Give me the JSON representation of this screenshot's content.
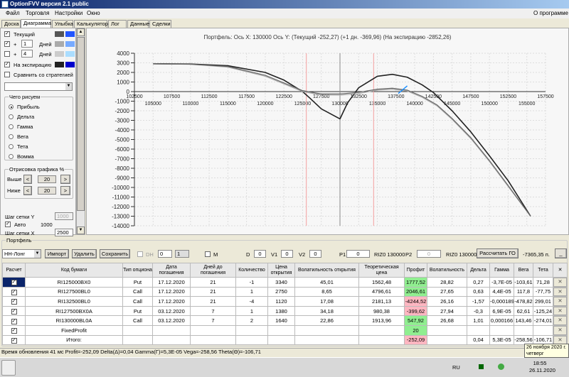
{
  "window": {
    "title": "OptionFVV версия 2.1 public"
  },
  "menu": {
    "items": [
      "Файл",
      "Торговля",
      "Настройки",
      "Окно"
    ],
    "about": "О программе"
  },
  "tabs": [
    "Доска",
    "Диаграмма",
    "Улыбка",
    "Калькулятор",
    "Лог",
    "Данные",
    "Сделки"
  ],
  "left": {
    "current_label": "Текущий",
    "plus_label": "+",
    "days1": "1",
    "days2": "4",
    "days_label": "Дней",
    "expiration_label": "На экспирацию",
    "compare_label": "Сравнить со стратегией",
    "swatches": [
      [
        "#555555",
        "#2255ff"
      ],
      [
        "#aaaaaa",
        "#77aaff"
      ],
      [
        "#cccccc",
        "#aaddff"
      ],
      [
        "#222222",
        "#0000cc"
      ]
    ],
    "draw_group": "Чего рисуем",
    "draw_options": [
      "Прибыль",
      "Дельта",
      "Гамма",
      "Вега",
      "Тета",
      "Вомма"
    ],
    "range_group": "Отрисовка графика %",
    "above_label": "Выше",
    "below_label": "Ниже",
    "above_value": "20",
    "below_value": "20",
    "prev": "<",
    "next": ">",
    "grid_y_label": "Шаг сетки Y",
    "grid_y_value": "1000",
    "auto_label": "Авто",
    "auto_value": "1000",
    "grid_x_label": "Шаг сетки X",
    "grid_x_value": "2500"
  },
  "chart_data": {
    "type": "line",
    "title": "Портфель: Ось X:  130000 Ось Y:   (Текущий -252,27)  (+1 дн. -369,96)  (На экспирацию -2852,26)",
    "xlim": [
      102500,
      157500
    ],
    "ylim": [
      -14000,
      4000
    ],
    "yticks": [
      4000,
      3000,
      2000,
      1000,
      0,
      -1000,
      -2000,
      -3000,
      -4000,
      -5000,
      -6000,
      -7000,
      -8000,
      -9000,
      -10000,
      -11000,
      -12000,
      -13000,
      -14000
    ],
    "xticks_top": [
      102500,
      107500,
      112500,
      117500,
      122500,
      127500,
      132500,
      137500,
      142500,
      147500,
      152500,
      157500
    ],
    "xticks_bottom": [
      105000,
      110000,
      115000,
      120000,
      125000,
      130000,
      135000,
      140000,
      145000,
      150000,
      155000
    ],
    "current_x": 130000,
    "red_lines": [
      125500,
      134500
    ],
    "series": [
      {
        "name": "На экспирацию",
        "color": "#222222",
        "points": [
          [
            105000,
            2900
          ],
          [
            110000,
            2880
          ],
          [
            115000,
            2700
          ],
          [
            120000,
            2000
          ],
          [
            122500,
            1200
          ],
          [
            125000,
            0
          ],
          [
            126000,
            -700
          ],
          [
            127500,
            -1800
          ],
          [
            130000,
            -2850
          ],
          [
            131000,
            -1200
          ],
          [
            132500,
            400
          ],
          [
            135000,
            1600
          ],
          [
            137000,
            1800
          ],
          [
            139000,
            1500
          ],
          [
            141000,
            700
          ],
          [
            142500,
            -100
          ],
          [
            145000,
            -2000
          ],
          [
            147500,
            -4200
          ],
          [
            150000,
            -6700
          ],
          [
            152500,
            -9300
          ],
          [
            155500,
            -13000
          ]
        ]
      },
      {
        "name": "+1 дн.",
        "color": "#aaaaaa",
        "points": [
          [
            105000,
            2900
          ],
          [
            110000,
            2840
          ],
          [
            115000,
            2550
          ],
          [
            120000,
            1600
          ],
          [
            122500,
            800
          ],
          [
            125000,
            0
          ],
          [
            127500,
            -350
          ],
          [
            130000,
            -370
          ],
          [
            132500,
            -200
          ],
          [
            135000,
            150
          ],
          [
            137000,
            250
          ],
          [
            139000,
            50
          ],
          [
            141000,
            -600
          ],
          [
            143000,
            -1500
          ],
          [
            145000,
            -2900
          ],
          [
            147500,
            -4900
          ],
          [
            150000,
            -7300
          ],
          [
            152500,
            -9900
          ],
          [
            155500,
            -13000
          ]
        ]
      },
      {
        "name": "Текущий",
        "color": "#666666",
        "points": [
          [
            105000,
            2900
          ],
          [
            110000,
            2860
          ],
          [
            115000,
            2620
          ],
          [
            120000,
            1700
          ],
          [
            122500,
            900
          ],
          [
            125000,
            100
          ],
          [
            127500,
            -250
          ],
          [
            130000,
            -252
          ],
          [
            132500,
            -80
          ],
          [
            135000,
            250
          ],
          [
            137000,
            350
          ],
          [
            139000,
            150
          ],
          [
            141000,
            -500
          ],
          [
            143000,
            -1400
          ],
          [
            145000,
            -2800
          ],
          [
            147500,
            -4800
          ],
          [
            150000,
            -7200
          ],
          [
            152500,
            -9800
          ],
          [
            155500,
            -13000
          ]
        ]
      },
      {
        "name": "marker",
        "color": "#1e90ff",
        "points": [
          [
            137800,
            -200
          ],
          [
            139000,
            600
          ]
        ]
      }
    ]
  },
  "portfolio": {
    "group": "Портфель",
    "strategy": "НН-Лонг",
    "import": "Импорт",
    "delete": "Удалить",
    "save": "Сохранить",
    "dh": "DH",
    "spin1": "0",
    "spin2": "1",
    "m": "M",
    "d_label": "D",
    "d": "0",
    "v1_label": "V1",
    "v1": "0",
    "v2_label": "V2",
    "v2": "0",
    "p1_label": "P1",
    "p1": "0",
    "riz1": "RIZ0 130000",
    "p2_label": "P2",
    "p2": "0",
    "riz2": "RIZ0 130000",
    "calc_go": "Рассчитать ГО",
    "go_value": "-7365,35 п.",
    "minimize": "_",
    "columns": [
      "Расчет",
      "Код бумаги",
      "Тип опциона",
      "Дата погашения",
      "Дней до погашения",
      "Количество",
      "Цена открытия",
      "Волатильность открытия",
      "Теоретическая цена",
      "Профит",
      "Волатильность",
      "Дельта",
      "Гамма",
      "Вега",
      "Тета",
      "✕"
    ],
    "rows": [
      [
        "RI125000BX0",
        "Put",
        "17.12.2020",
        "21",
        "-1",
        "3340",
        "45,01",
        "1562,48",
        "1777,52",
        "28,82",
        "0,27",
        "-3,7E-05",
        "-103,61",
        "71,28"
      ],
      [
        "RI127500BL0",
        "Call",
        "17.12.2020",
        "21",
        "1",
        "2750",
        "8,65",
        "4796,61",
        "2046,61",
        "27,65",
        "0,63",
        "4,4E-05",
        "117,8",
        "-77,75"
      ],
      [
        "RI132500BL0",
        "Call",
        "17.12.2020",
        "21",
        "-4",
        "1120",
        "17,08",
        "2181,13",
        "-4244,52",
        "26,16",
        "-1,57",
        "-0,000189",
        "-478,82",
        "299,01"
      ],
      [
        "RI127500BX0A",
        "Put",
        "03.12.2020",
        "7",
        "1",
        "1380",
        "34,18",
        "980,38",
        "-399,62",
        "27,94",
        "-0,3",
        "6,9E-05",
        "62,61",
        "-125,24"
      ],
      [
        "RI130000BL0A",
        "Call",
        "03.12.2020",
        "7",
        "2",
        "1640",
        "22,86",
        "1913,96",
        "547,92",
        "26,68",
        "1,01",
        "0,000166",
        "143,46",
        "-274,01"
      ],
      [
        "FixedProfit",
        "",
        "",
        "",
        "",
        "",
        "",
        "",
        "20",
        "",
        "",
        "",
        "",
        ""
      ],
      [
        "Итого:",
        "",
        "",
        "",
        "",
        "",
        "",
        "",
        "-252,09",
        "",
        "0,04",
        "5,3E-05",
        "-258,56",
        "-106,71"
      ]
    ]
  },
  "status": "Время обновления 41 мс  Profit=-252,09 Delta(Δ)=0,04 Gamma(Γ)=5,3E-05 Vega=-258,56 Theta(Θ)=-106,71",
  "tooltip": {
    "line1": "26 ноября 2020 г.",
    "line2": "четверг"
  },
  "taskbar": {
    "lang": "RU",
    "time": "18:55",
    "date": "26.11.2020"
  }
}
